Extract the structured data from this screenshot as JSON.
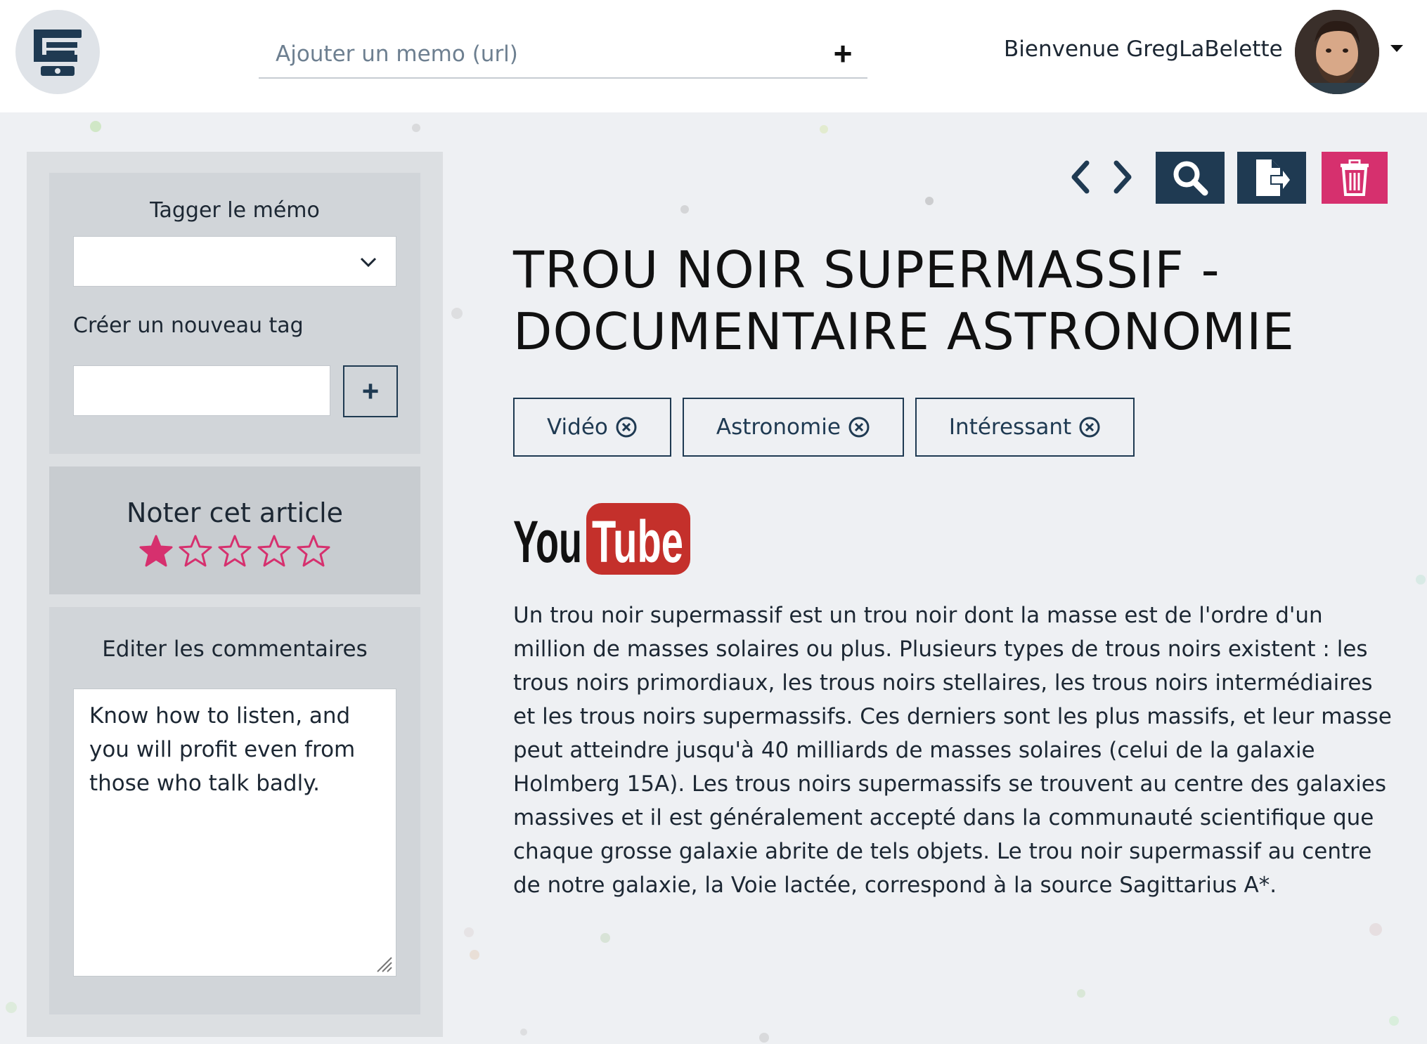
{
  "header": {
    "logo_icon": "robot-logo-icon",
    "memo_placeholder": "Ajouter un memo (url)",
    "memo_add_label": "+",
    "welcome_text": "Bienvenue GregLaBelette"
  },
  "sidebar": {
    "tag_title": "Tagger le mémo",
    "tag_select_value": "",
    "new_tag_label": "Créer un nouveau tag",
    "new_tag_value": "",
    "new_tag_add_label": "+",
    "rate_title": "Noter cet article",
    "rating": 1,
    "rating_max": 5,
    "comments_title": "Editer les commentaires",
    "comment_text": "Know how to listen, and you will profit even from those who talk badly."
  },
  "main": {
    "title": "TROU NOIR SUPERMASSIF - DOCUMENTAIRE ASTRONOMIE",
    "tags": [
      {
        "label": "Vidéo"
      },
      {
        "label": "Astronomie"
      },
      {
        "label": "Intéressant"
      }
    ],
    "source_logo_you": "You",
    "source_logo_tube": "Tube",
    "description": "Un trou noir supermassif est un trou noir dont la masse est de l'ordre d'un million de masses solaires ou plus. Plusieurs types de trous noirs existent : les trous noirs primordiaux, les trous noirs stellaires, les trous noirs intermédiaires et les trous noirs supermassifs. Ces derniers sont les plus massifs, et leur masse peut atteindre jusqu'à 40 milliards de masses solaires (celui de la galaxie Holmberg 15A). Les trous noirs supermassifs se trouvent au centre des galaxies massives et il est généralement accepté dans la communauté scientifique que chaque grosse galaxie abrite de tels objets. Le trou noir supermassif au centre de notre galaxie, la Voie lactée, correspond à la source Sagittarius A*."
  },
  "colors": {
    "navy": "#1f3a52",
    "pink": "#d6306e",
    "youtube_red": "#c4302b"
  }
}
